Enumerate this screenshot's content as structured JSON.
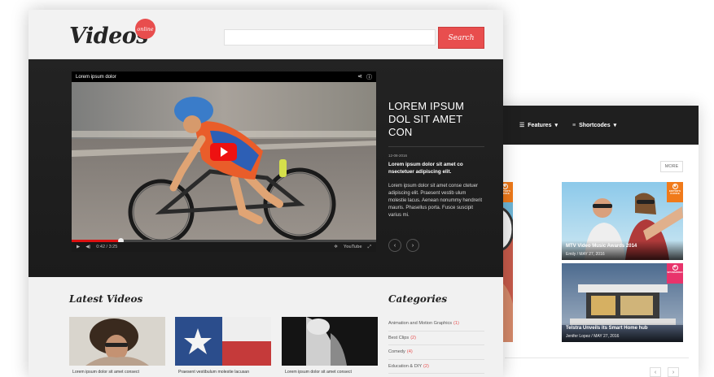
{
  "brand": {
    "logo": "Videos",
    "badge": "online",
    "accent": "#e84e4e"
  },
  "search": {
    "placeholder": "",
    "button_label": "Search"
  },
  "player": {
    "title": "Lorem ipsum dolor",
    "time": "0:42 / 3:25",
    "progress_pct": 16,
    "brand_mark": "YouTube"
  },
  "featured": {
    "title": "LOREM IPSUM DOL SIT AMET CON",
    "date": "12-08-2016",
    "subtitle": "Lorem ipsum dolor sit amet co nsectetuer adipiscing elit.",
    "body": "Lorem ipsum dolor sit amet conse ctetuer adipiscing elit. Praesent vestib ulum molestie lacus. Aenean nonummy hendrerit mauris. Phasellus porta. Fusce suscipit varius mi.",
    "prev": "‹",
    "next": "›"
  },
  "latest": {
    "heading": "Latest Videos",
    "items": [
      {
        "caption": "Lorem ipsum dolor sit amet consect"
      },
      {
        "caption": "Praesent vestibulum molestie lacusan"
      },
      {
        "caption": "Lorem ipsum dolor sit amet consect"
      }
    ]
  },
  "categories": {
    "heading": "Categories",
    "items": [
      {
        "label": "Animation and Motion Graphics",
        "count": "(1)"
      },
      {
        "label": "Best Clips",
        "count": "(2)"
      },
      {
        "label": "Comedy",
        "count": "(4)"
      },
      {
        "label": "Education & DIY",
        "count": "(2)"
      }
    ]
  },
  "back_window": {
    "nav": [
      {
        "label": "Features",
        "caret": "▾"
      },
      {
        "label": "Shortcodes",
        "caret": "▾"
      }
    ],
    "more_label": "MORE",
    "cards": [
      {
        "title": "MTV Video Music Awards 2014",
        "author": "Emily",
        "date": "MAY 27, 2016",
        "badge": "EDITOR'S CHOICE",
        "badge_color": "#f07a1a"
      },
      {
        "title": "Telstra Unveils its Smart Home hub",
        "author": "Jenifer Lopez",
        "date": "MAY 27, 2016",
        "badge": "SPONSORED",
        "badge_color": "#e8336b"
      }
    ],
    "partial_badge": "EDITOR'S CHOICE",
    "pager_prev": "‹",
    "pager_next": "›"
  }
}
